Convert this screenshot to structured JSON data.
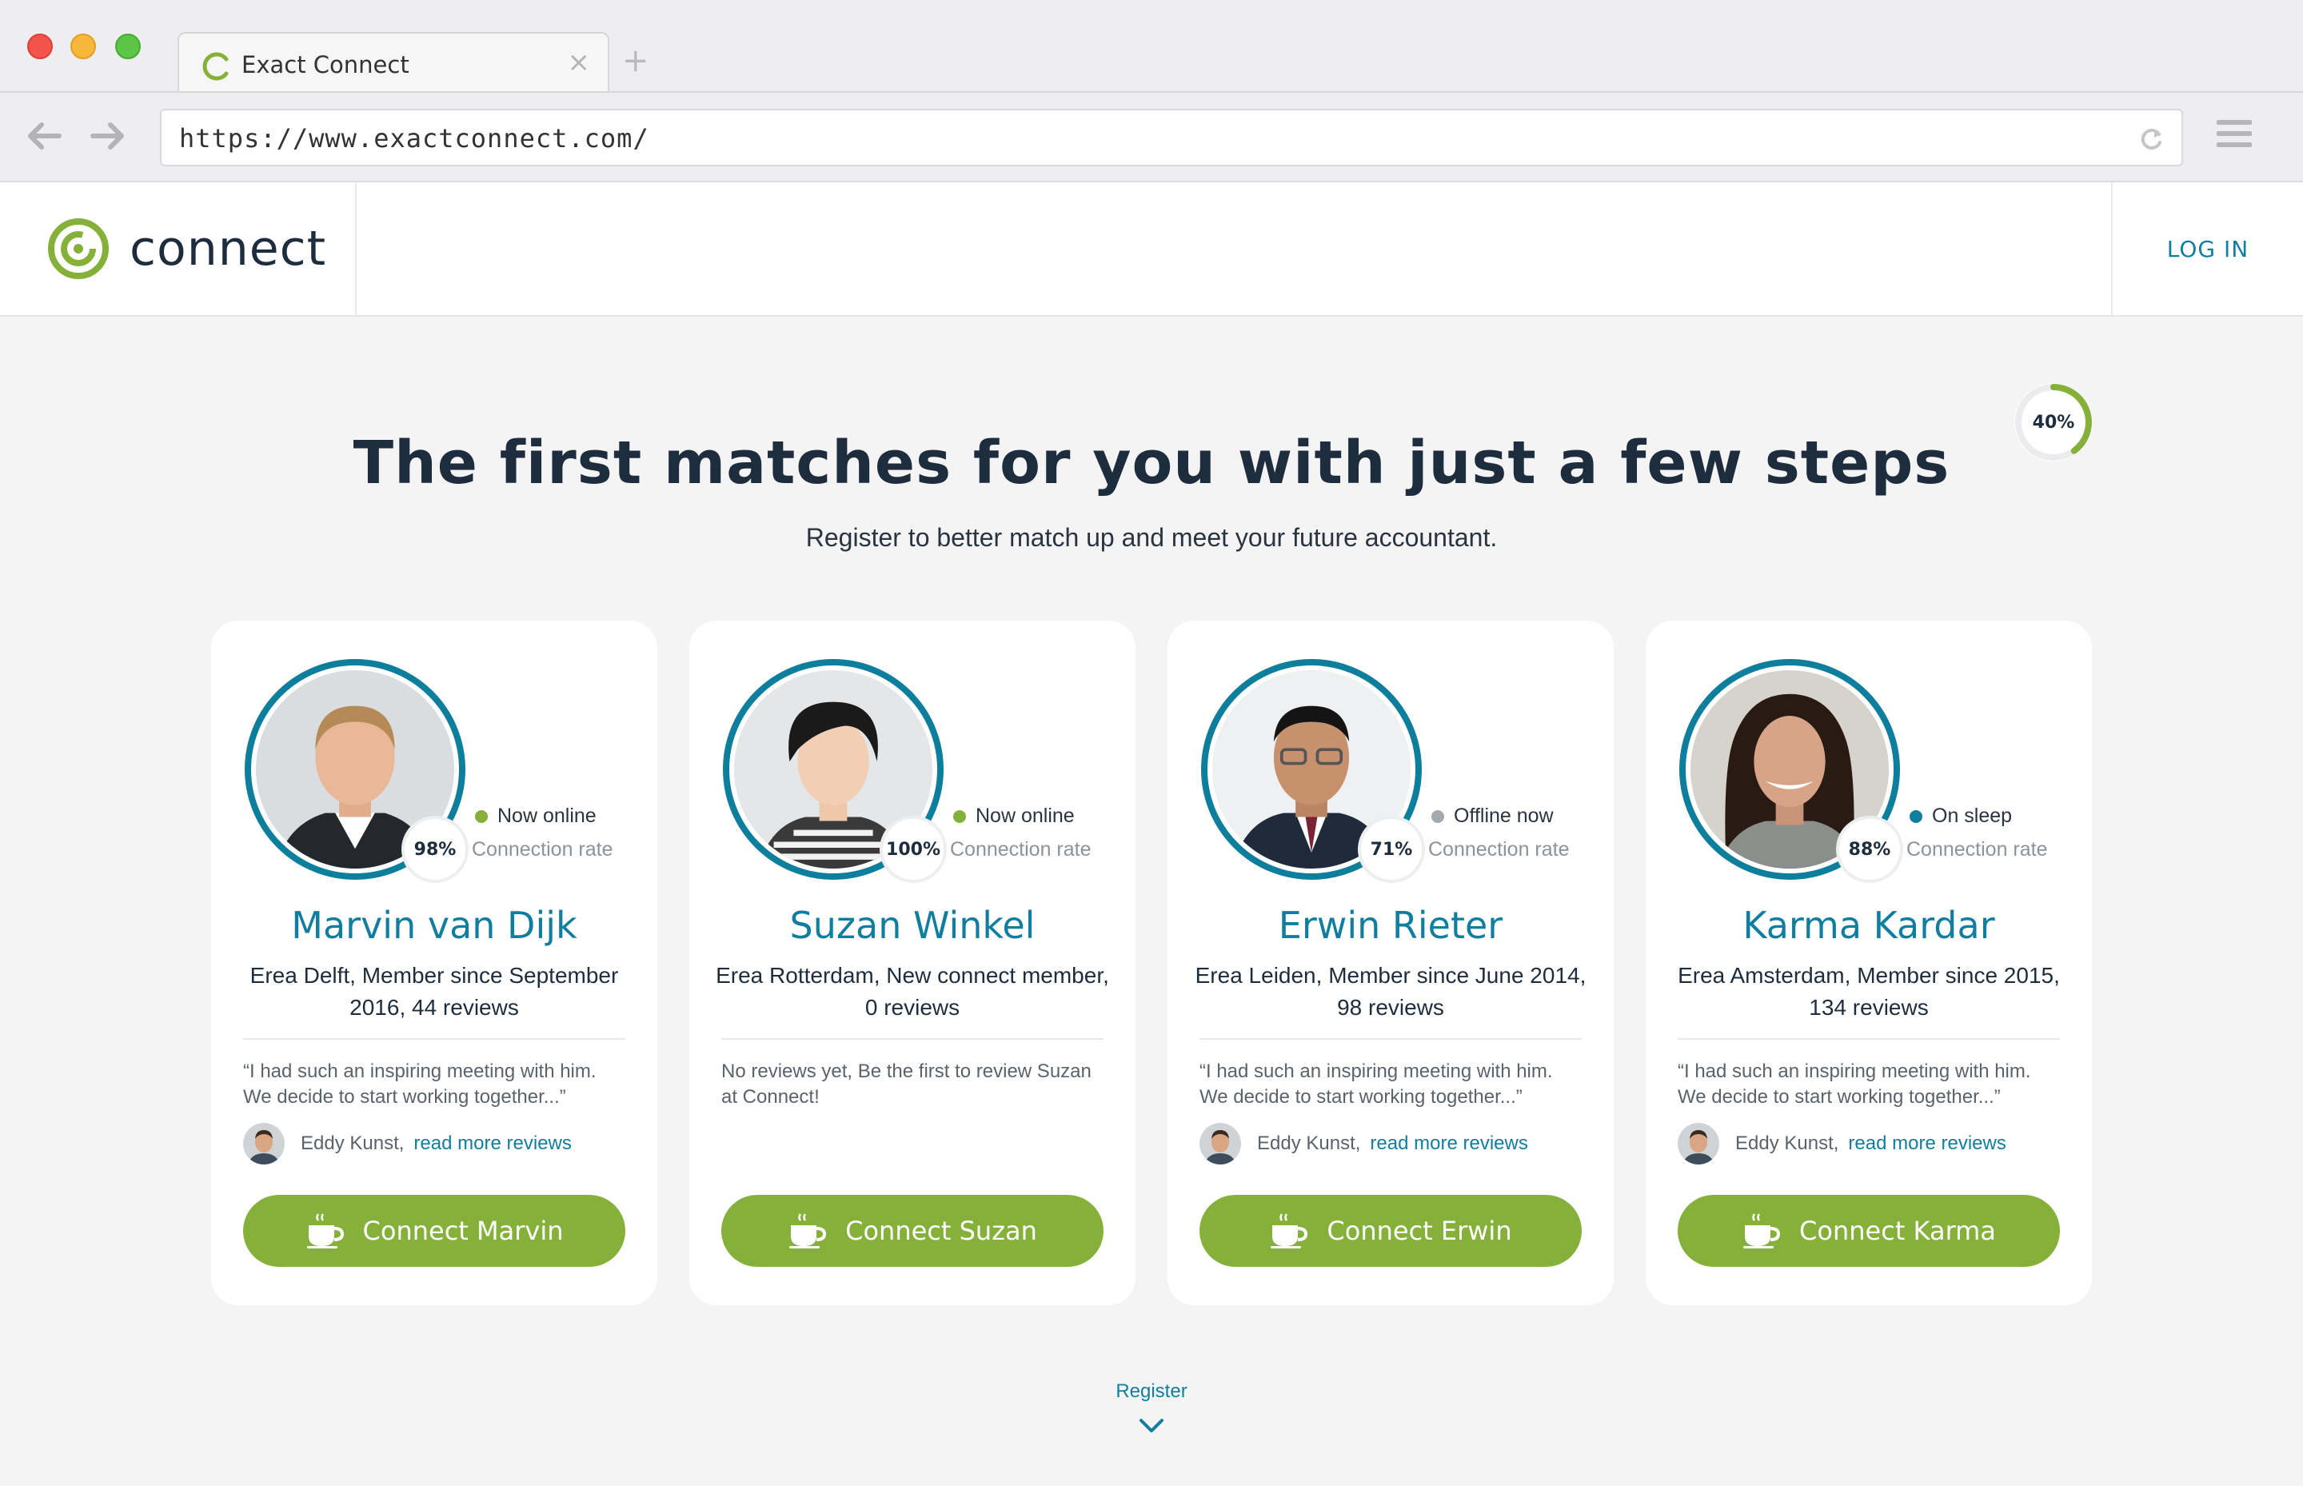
{
  "browser": {
    "tab_title": "Exact Connect",
    "tab_close": "×",
    "new_tab": "+",
    "url": "https://www.exactconnect.com/"
  },
  "header": {
    "logo_text": "connect",
    "login_label": "LOG IN"
  },
  "progress": {
    "value": 0.4,
    "label": "40%"
  },
  "hero": {
    "title": "The first matches for you with just a few steps",
    "subtitle": "Register to better match up and meet your future accountant."
  },
  "colors": {
    "brand_green": "#85b13a",
    "brand_blue": "#117ea0",
    "online": "#85b13a",
    "offline": "#a3a9ae",
    "sleep": "#117ea0"
  },
  "cards": [
    {
      "rate": "98%",
      "status": "Now online",
      "status_color": "#85b13a",
      "rate_label": "Connection rate",
      "name": "Marvin van Dijk",
      "meta": "Erea Delft, Member since September 2016, 44 reviews",
      "quote": "“I had such an inspiring meeting with him. We decide to start working together...”",
      "reviewer": "Eddy Kunst,",
      "reviews_link": "read more reviews",
      "button": "Connect Marvin"
    },
    {
      "rate": "100%",
      "status": "Now online",
      "status_color": "#85b13a",
      "rate_label": "Connection rate",
      "name": "Suzan Winkel",
      "meta": "Erea Rotterdam, New connect member, 0 reviews",
      "quote": "No reviews yet, Be the first to review Suzan at Connect!",
      "reviewer": "",
      "reviews_link": "",
      "button": "Connect Suzan"
    },
    {
      "rate": "71%",
      "status": "Offline now",
      "status_color": "#a3a9ae",
      "rate_label": "Connection rate",
      "name": "Erwin Rieter",
      "meta": "Erea Leiden, Member since June 2014, 98 reviews",
      "quote": "“I had such an inspiring meeting with him. We decide to start working together...”",
      "reviewer": "Eddy Kunst,",
      "reviews_link": "read more reviews",
      "button": "Connect Erwin"
    },
    {
      "rate": "88%",
      "status": "On sleep",
      "status_color": "#117ea0",
      "rate_label": "Connection rate",
      "name": "Karma Kardar",
      "meta": "Erea Amsterdam, Member since 2015, 134 reviews",
      "quote": "“I had such an inspiring meeting with him. We decide to start working together...”",
      "reviewer": "Eddy Kunst,",
      "reviews_link": "read more reviews",
      "button": "Connect Karma"
    }
  ],
  "footer": {
    "register_label": "Register"
  }
}
